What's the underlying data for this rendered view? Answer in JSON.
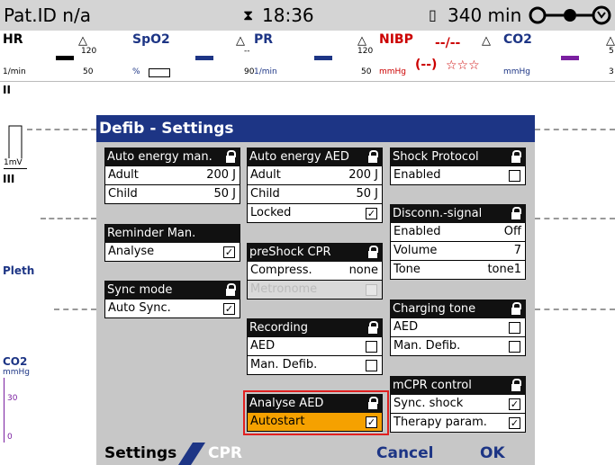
{
  "status": {
    "patient_id": "Pat.ID n/a",
    "time": "18:36",
    "battery": "340 min"
  },
  "params": {
    "hr": {
      "label": "HR",
      "unit": "1/min",
      "high": "",
      "low": ""
    },
    "spo2": {
      "label": "SpO2",
      "unit": "%",
      "high": "120",
      "low": "50"
    },
    "pr": {
      "label": "PR",
      "unit": "1/min",
      "high": "--",
      "low": "90"
    },
    "nibp": {
      "label": "NIBP",
      "unit": "mmHg",
      "value": "--/--",
      "mean": "(--)",
      "stars": "☆☆☆",
      "high": "120",
      "low": "50"
    },
    "co2": {
      "label": "CO2",
      "unit": "mmHg",
      "high": "5",
      "low": "3"
    }
  },
  "waves": {
    "ecg2": "II",
    "scale": "1mV",
    "ecg3": "III",
    "pleth": "Pleth",
    "co2": "CO2",
    "co2_unit": "mmHg",
    "co2_t30": "30",
    "co2_t0": "0"
  },
  "dialog": {
    "title": "Defib - Settings",
    "auto_energy_man": {
      "title": "Auto energy man.",
      "adult": "Adult",
      "adult_val": "200 J",
      "child": "Child",
      "child_val": "50 J"
    },
    "reminder_man": {
      "title": "Reminder Man.",
      "analyse": "Analyse"
    },
    "sync_mode": {
      "title": "Sync mode",
      "auto_sync": "Auto Sync."
    },
    "auto_energy_aed": {
      "title": "Auto energy AED",
      "adult": "Adult",
      "adult_val": "200 J",
      "child": "Child",
      "child_val": "50 J",
      "locked": "Locked"
    },
    "preshock_cpr": {
      "title": "preShock CPR",
      "compress": "Compress.",
      "compress_val": "none",
      "metronome": "Metronome"
    },
    "recording": {
      "title": "Recording",
      "aed": "AED",
      "man_defib": "Man. Defib."
    },
    "analyse_aed": {
      "title": "Analyse AED",
      "autostart": "Autostart"
    },
    "shock_protocol": {
      "title": "Shock Protocol",
      "enabled": "Enabled"
    },
    "disconn_signal": {
      "title": "Disconn.-signal",
      "enabled": "Enabled",
      "enabled_val": "Off",
      "volume": "Volume",
      "volume_val": "7",
      "tone": "Tone",
      "tone_val": "tone1"
    },
    "charging_tone": {
      "title": "Charging tone",
      "aed": "AED",
      "man_defib": "Man. Defib."
    },
    "mcpr_control": {
      "title": "mCPR control",
      "sync_shock": "Sync. shock",
      "therapy_param": "Therapy param."
    }
  },
  "bottom": {
    "settings": "Settings",
    "cpr": "CPR",
    "cancel": "Cancel",
    "ok": "OK"
  },
  "colors": {
    "accent_blue": "#1d3585",
    "highlight_orange": "#f5a100",
    "nibp_red": "#cc0000",
    "selection_red": "#e02020"
  }
}
